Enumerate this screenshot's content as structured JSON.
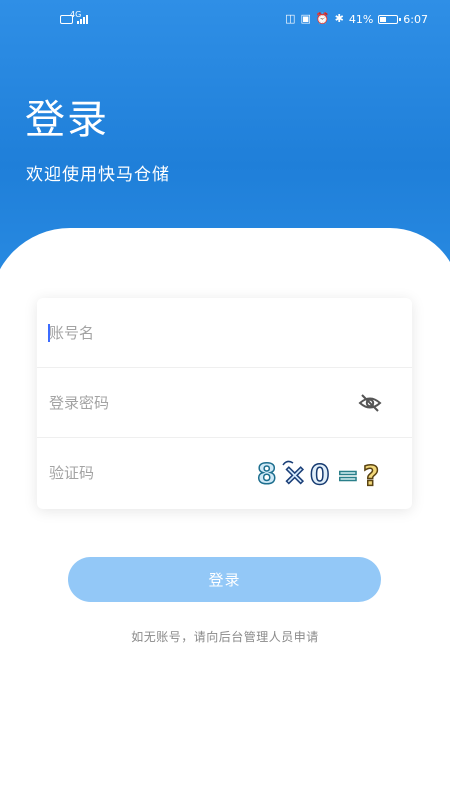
{
  "status_bar": {
    "network_label": "4G",
    "battery_percent": "41%",
    "time": "6:07",
    "battery_level": 0.41,
    "icons": [
      "sim-icon",
      "signal-icon",
      "vibrate-icon",
      "nfc-icon",
      "alarm-icon",
      "bluetooth-icon",
      "battery-icon"
    ]
  },
  "header": {
    "title": "登录",
    "subtitle": "欢迎使用快马仓储"
  },
  "form": {
    "username_placeholder": "账号名",
    "password_placeholder": "登录密码",
    "captcha_placeholder": "验证码",
    "captcha_icon": "eye-off-icon",
    "captcha_text": "8×0=?"
  },
  "login_button_label": "登录",
  "footer_hint": "如无账号，请向后台管理人员申请",
  "colors": {
    "header_blue": "#2a8ce3",
    "button_blue": "#93c8f7",
    "caret_blue": "#3c6cff",
    "placeholder_gray": "#a3a3a3",
    "hint_gray": "#8a8a8a"
  }
}
